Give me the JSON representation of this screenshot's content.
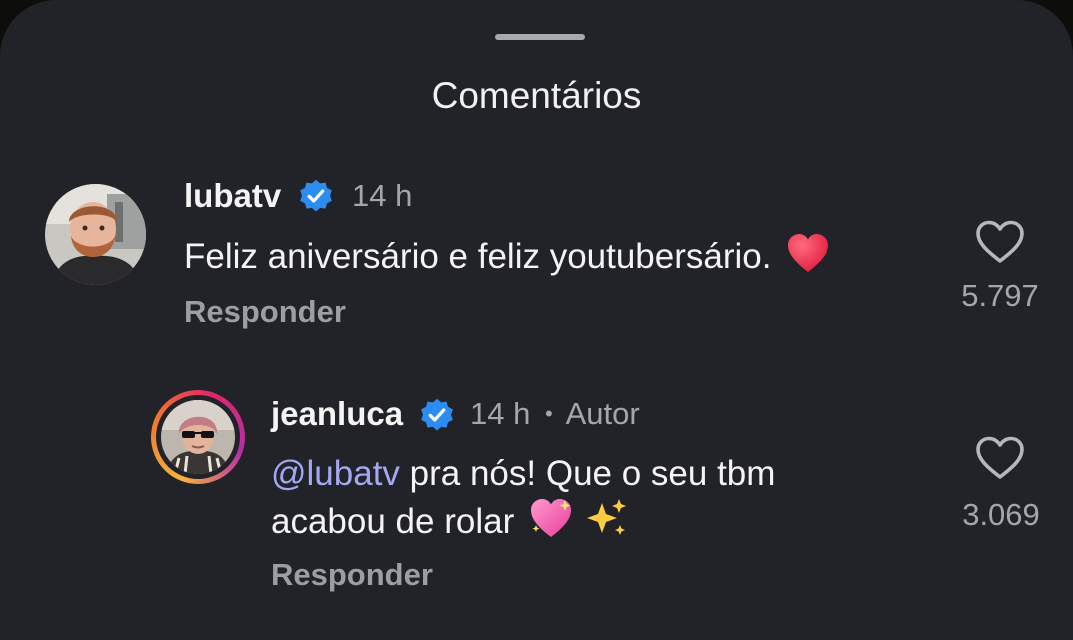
{
  "sheet": {
    "title": "Comentários"
  },
  "comments": [
    {
      "username": "lubatv",
      "verified": true,
      "time": "14 h",
      "text": "Feliz aniversário e feliz youtubersário.",
      "emoji": "red-heart",
      "reply_label": "Responder",
      "likes": "5.797"
    },
    {
      "username": "jeanluca",
      "verified": true,
      "time": "14 h",
      "separator": "•",
      "author_badge": "Autor",
      "mention": "@lubatv",
      "text_line1": " pra nós! Que o seu tbm",
      "text_line2": "acabou de rolar",
      "emoji": [
        "sparkling-heart",
        "sparkles"
      ],
      "reply_label": "Responder",
      "likes": "3.069"
    }
  ],
  "colors": {
    "background": "#212328",
    "mention": "#a3a8f3",
    "verified": "#2d8cf0"
  }
}
